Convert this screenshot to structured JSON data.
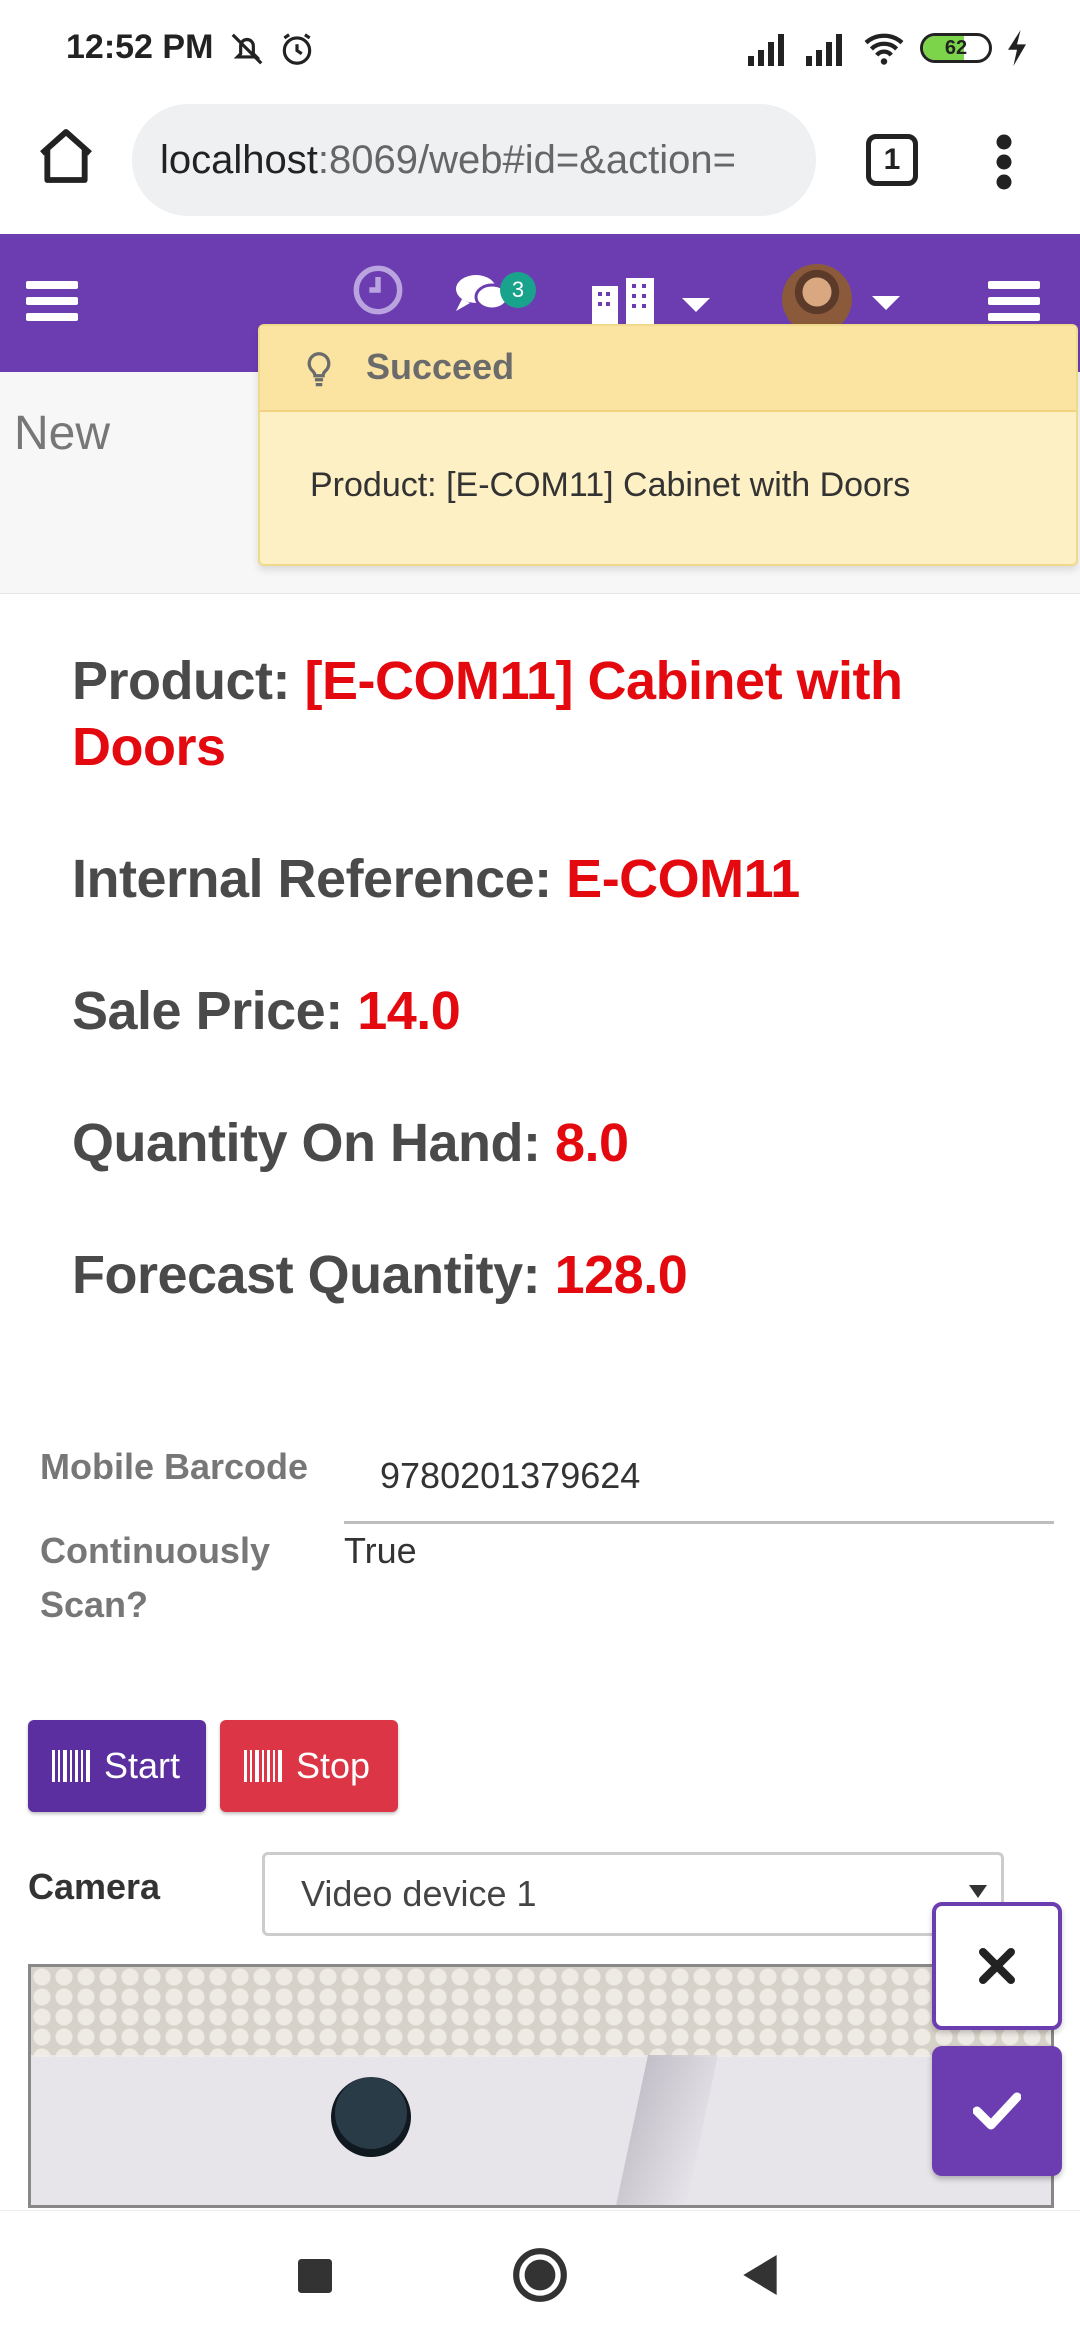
{
  "status_bar": {
    "time": "12:52 PM",
    "battery_level": "62",
    "battery_fraction": 0.62
  },
  "browser": {
    "url_host": "localhost",
    "url_path": ":8069/web#id=&action=",
    "tab_count": "1"
  },
  "navbar": {
    "chat_badge": "3"
  },
  "control_panel": {
    "breadcrumb": "New"
  },
  "notification": {
    "title": "Succeed",
    "message": "Product: [E-COM11] Cabinet with Doors"
  },
  "product_info": {
    "product_label": "Product: ",
    "product_value": "[E-COM11] Cabinet with Doors",
    "internal_ref_label": "Internal Reference: ",
    "internal_ref_value": "E-COM11",
    "sale_price_label": "Sale Price: ",
    "sale_price_value": "14.0",
    "qty_on_hand_label": "Quantity On Hand: ",
    "qty_on_hand_value": "8.0",
    "forecast_label": "Forecast Quantity: ",
    "forecast_value": "128.0"
  },
  "form": {
    "barcode_label": "Mobile Barcode",
    "barcode_value": "9780201379624",
    "continuous_label_line1": "Continuously",
    "continuous_label_line2": "Scan?",
    "continuous_value": "True"
  },
  "buttons": {
    "start_label": "Start",
    "stop_label": "Stop"
  },
  "camera": {
    "label": "Camera",
    "selected": "Video device 1"
  },
  "colors": {
    "brand": "#6c3db0",
    "value_red": "#e3090f",
    "stop_red": "#dc3545",
    "notify_bg": "#fdf0c4"
  },
  "icons": [
    "home-icon",
    "tabs-icon",
    "more-vert-icon",
    "menu-icon",
    "clock-icon",
    "chat-icon",
    "building-icon",
    "avatar",
    "bulb-icon",
    "barcode-icon",
    "close-icon",
    "check-icon",
    "square-icon",
    "circle-icon",
    "back-icon"
  ]
}
